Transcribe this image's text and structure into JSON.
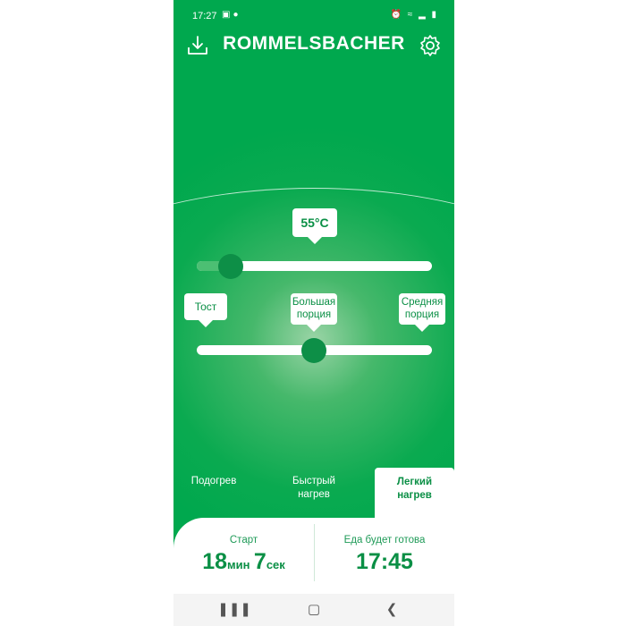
{
  "status_bar": {
    "time": "17:27",
    "left_icons": [
      "image-icon",
      "location-icon"
    ],
    "right_icons": [
      "alarm-icon",
      "wifi-icon",
      "signal-icon",
      "battery-icon"
    ]
  },
  "header": {
    "logo": "ROMMELSBACHER",
    "download_icon": "download-icon",
    "settings_icon": "gear-icon"
  },
  "temperature": {
    "value_label": "55°C",
    "level": 0.13
  },
  "mode_slider": {
    "options": [
      "Тост",
      "Большая порция",
      "Средняя порция"
    ],
    "option_lines": {
      "toast": "Тост",
      "big_line1": "Большая",
      "big_line2": "порция",
      "med_line1": "Средняя",
      "med_line2": "порция"
    },
    "selected": "Большая порция",
    "level": 0.5
  },
  "tabs": {
    "reheat": "Подогрев",
    "fast_line1": "Быстрый",
    "fast_line2": "нагрев",
    "light_line1": "Легкий",
    "light_line2": "нагрев",
    "active": "Легкий нагрев"
  },
  "panel": {
    "start_label": "Старт",
    "timer_min": "18",
    "timer_min_unit": "мин",
    "timer_sec": "7",
    "timer_sec_unit": "сек",
    "ready_label": "Еда будет готова",
    "ready_time": "17:45"
  },
  "colors": {
    "brand_green": "#00a84e",
    "dark_green": "#0d8f47",
    "white": "#ffffff"
  }
}
